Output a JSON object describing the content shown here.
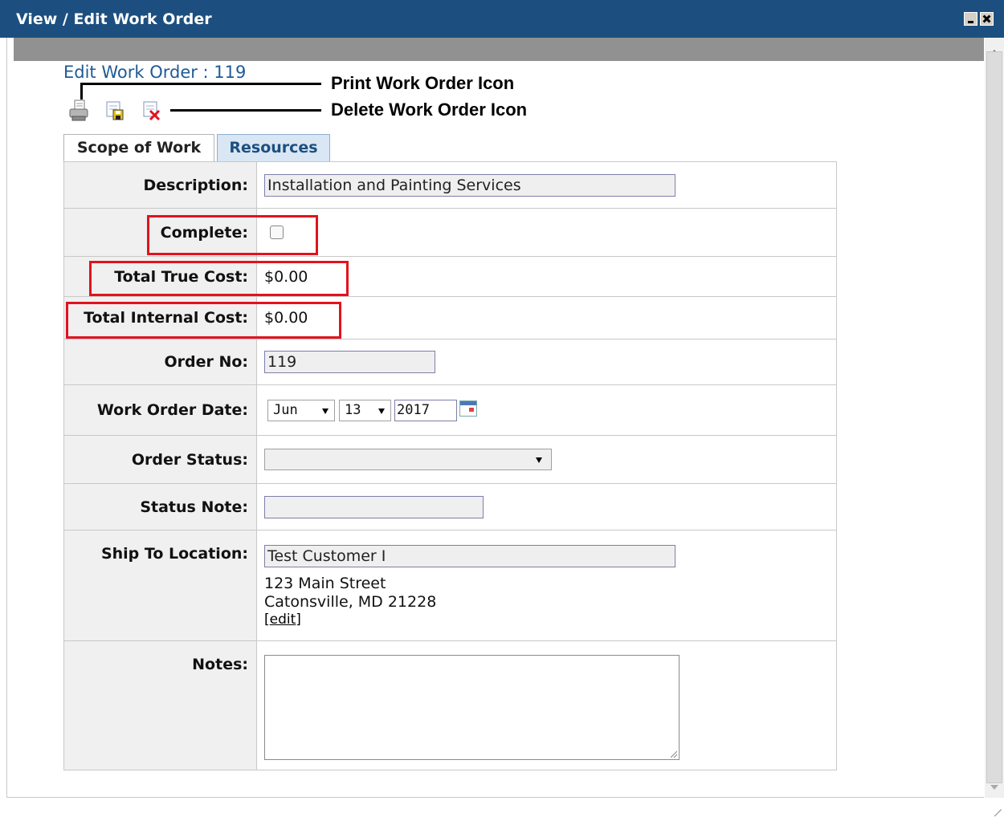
{
  "window": {
    "title": "View / Edit Work Order",
    "minimize_icon": "minimize-icon",
    "close_icon": "close-icon"
  },
  "page": {
    "heading": "Edit Work Order : 119"
  },
  "toolbar": {
    "print_icon": "printer-icon",
    "save_icon": "save-icon",
    "delete_icon": "delete-icon"
  },
  "annotations": {
    "print": "Print Work Order Icon",
    "delete": "Delete Work Order Icon"
  },
  "tabs": [
    {
      "label": "Scope of Work",
      "active": true
    },
    {
      "label": "Resources",
      "active": false
    }
  ],
  "form": {
    "description": {
      "label": "Description:",
      "value": "Installation and Painting Services"
    },
    "complete": {
      "label": "Complete:",
      "checked": false
    },
    "total_true_cost": {
      "label": "Total True Cost:",
      "value": "$0.00"
    },
    "total_internal_cost": {
      "label": "Total Internal Cost:",
      "value": "$0.00"
    },
    "order_no": {
      "label": "Order No:",
      "value": "119"
    },
    "work_order_date": {
      "label": "Work Order Date:",
      "month": "Jun",
      "day": "13",
      "year": "2017"
    },
    "order_status": {
      "label": "Order Status:",
      "value": ""
    },
    "status_note": {
      "label": "Status Note:",
      "value": ""
    },
    "ship_to": {
      "label": "Ship To Location:",
      "value": "Test Customer I",
      "address_line1": "123 Main Street",
      "address_line2": "Catonsville, MD 21228",
      "edit_open": "[",
      "edit_label": "edit",
      "edit_close": "]"
    },
    "notes": {
      "label": "Notes:",
      "value": ""
    }
  },
  "colors": {
    "titlebar": "#1c4f80",
    "heading": "#1f5a96",
    "highlight_box": "#e3121e",
    "tab_inactive_bg": "#d9e6f3"
  }
}
